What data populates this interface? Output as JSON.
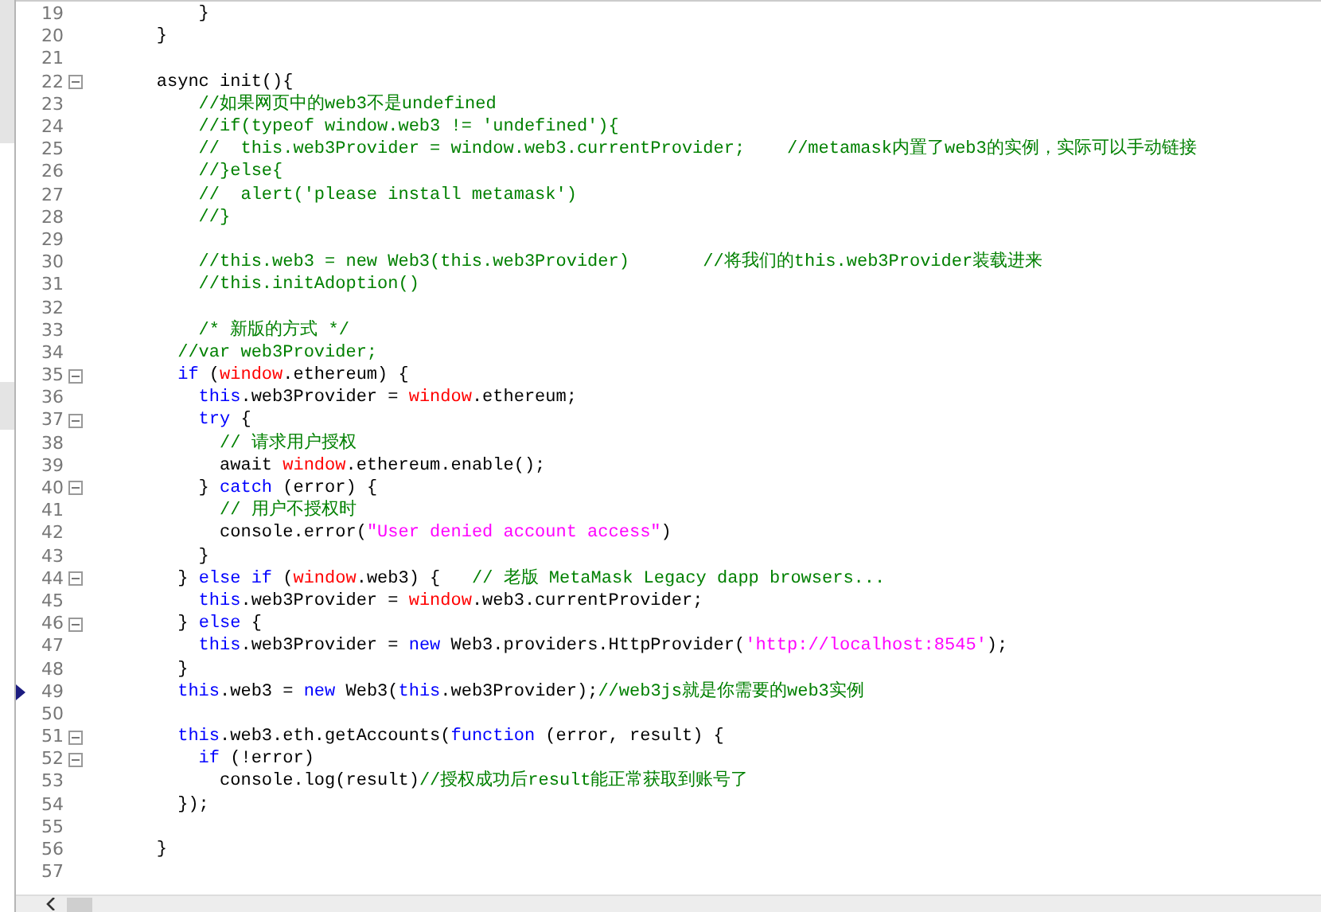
{
  "editor": {
    "lines": [
      {
        "number": "19",
        "foldable": false,
        "bookmark": false,
        "tokens": [
          {
            "kind": "text",
            "text": "        }"
          }
        ]
      },
      {
        "number": "20",
        "foldable": false,
        "bookmark": false,
        "tokens": [
          {
            "kind": "text",
            "text": "    }"
          }
        ]
      },
      {
        "number": "21",
        "foldable": false,
        "bookmark": false
      },
      {
        "number": "22",
        "foldable": true,
        "bookmark": false,
        "tokens": [
          {
            "kind": "text",
            "text": "    async init(){"
          }
        ]
      },
      {
        "number": "23",
        "foldable": false,
        "bookmark": false,
        "tokens": [
          {
            "kind": "comment",
            "text": "        //如果网页中的web3不是undefined"
          }
        ]
      },
      {
        "number": "24",
        "foldable": false,
        "bookmark": false,
        "tokens": [
          {
            "kind": "comment",
            "text": "        //if(typeof window.web3 != 'undefined'){"
          }
        ]
      },
      {
        "number": "25",
        "foldable": false,
        "bookmark": false,
        "tokens": [
          {
            "kind": "comment",
            "text": "        //  this.web3Provider = window.web3.currentProvider;    //metamask内置了web3的实例，实际可以手动链接"
          }
        ]
      },
      {
        "number": "26",
        "foldable": false,
        "bookmark": false,
        "tokens": [
          {
            "kind": "comment",
            "text": "        //}else{"
          }
        ]
      },
      {
        "number": "27",
        "foldable": false,
        "bookmark": false,
        "tokens": [
          {
            "kind": "comment",
            "text": "        //  alert('please install metamask')"
          }
        ]
      },
      {
        "number": "28",
        "foldable": false,
        "bookmark": false,
        "tokens": [
          {
            "kind": "comment",
            "text": "        //}"
          }
        ]
      },
      {
        "number": "29",
        "foldable": false,
        "bookmark": false
      },
      {
        "number": "30",
        "foldable": false,
        "bookmark": false,
        "tokens": [
          {
            "kind": "comment",
            "text": "        //this.web3 = new Web3(this.web3Provider)       //将我们的this.web3Provider装载进来"
          }
        ]
      },
      {
        "number": "31",
        "foldable": false,
        "bookmark": false,
        "tokens": [
          {
            "kind": "comment",
            "text": "        //this.initAdoption()"
          }
        ]
      },
      {
        "number": "32",
        "foldable": false,
        "bookmark": false
      },
      {
        "number": "33",
        "foldable": false,
        "bookmark": false,
        "tokens": [
          {
            "kind": "comment",
            "text": "        /* 新版的方式 */"
          }
        ]
      },
      {
        "number": "34",
        "foldable": false,
        "bookmark": false,
        "tokens": [
          {
            "kind": "comment",
            "text": "      //var web3Provider;"
          }
        ]
      },
      {
        "number": "35",
        "foldable": true,
        "bookmark": false,
        "tokens": [
          {
            "kind": "keyword",
            "text": "      if"
          },
          {
            "kind": "text",
            "text": " ("
          },
          {
            "kind": "global",
            "text": "window"
          },
          {
            "kind": "text",
            "text": ".ethereum) {"
          }
        ]
      },
      {
        "number": "36",
        "foldable": false,
        "bookmark": false,
        "tokens": [
          {
            "kind": "keyword",
            "text": "        this"
          },
          {
            "kind": "text",
            "text": ".web3Provider = "
          },
          {
            "kind": "global",
            "text": "window"
          },
          {
            "kind": "text",
            "text": ".ethereum;"
          }
        ]
      },
      {
        "number": "37",
        "foldable": true,
        "bookmark": false,
        "tokens": [
          {
            "kind": "keyword",
            "text": "        try"
          },
          {
            "kind": "text",
            "text": " {"
          }
        ]
      },
      {
        "number": "38",
        "foldable": false,
        "bookmark": false,
        "tokens": [
          {
            "kind": "comment",
            "text": "          // 请求用户授权"
          }
        ]
      },
      {
        "number": "39",
        "foldable": false,
        "bookmark": false,
        "tokens": [
          {
            "kind": "text",
            "text": "          await "
          },
          {
            "kind": "global",
            "text": "window"
          },
          {
            "kind": "text",
            "text": ".ethereum.enable();"
          }
        ]
      },
      {
        "number": "40",
        "foldable": true,
        "bookmark": false,
        "tokens": [
          {
            "kind": "text",
            "text": "        } "
          },
          {
            "kind": "keyword",
            "text": "catch"
          },
          {
            "kind": "text",
            "text": " (error) {"
          }
        ]
      },
      {
        "number": "41",
        "foldable": false,
        "bookmark": false,
        "tokens": [
          {
            "kind": "comment",
            "text": "          // 用户不授权时"
          }
        ]
      },
      {
        "number": "42",
        "foldable": false,
        "bookmark": false,
        "tokens": [
          {
            "kind": "text",
            "text": "          console.error("
          },
          {
            "kind": "string",
            "text": "\"User denied account access\""
          },
          {
            "kind": "text",
            "text": ")"
          }
        ]
      },
      {
        "number": "43",
        "foldable": false,
        "bookmark": false,
        "tokens": [
          {
            "kind": "text",
            "text": "        }"
          }
        ]
      },
      {
        "number": "44",
        "foldable": true,
        "bookmark": false,
        "tokens": [
          {
            "kind": "text",
            "text": "      } "
          },
          {
            "kind": "keyword",
            "text": "else if"
          },
          {
            "kind": "text",
            "text": " ("
          },
          {
            "kind": "global",
            "text": "window"
          },
          {
            "kind": "text",
            "text": ".web3) {   "
          },
          {
            "kind": "comment",
            "text": "// 老版 MetaMask Legacy dapp browsers..."
          }
        ]
      },
      {
        "number": "45",
        "foldable": false,
        "bookmark": false,
        "tokens": [
          {
            "kind": "keyword",
            "text": "        this"
          },
          {
            "kind": "text",
            "text": ".web3Provider = "
          },
          {
            "kind": "global",
            "text": "window"
          },
          {
            "kind": "text",
            "text": ".web3.currentProvider;"
          }
        ]
      },
      {
        "number": "46",
        "foldable": true,
        "bookmark": false,
        "tokens": [
          {
            "kind": "text",
            "text": "      } "
          },
          {
            "kind": "keyword",
            "text": "else"
          },
          {
            "kind": "text",
            "text": " {"
          }
        ]
      },
      {
        "number": "47",
        "foldable": false,
        "bookmark": false,
        "tokens": [
          {
            "kind": "keyword",
            "text": "        this"
          },
          {
            "kind": "text",
            "text": ".web3Provider = "
          },
          {
            "kind": "keyword",
            "text": "new"
          },
          {
            "kind": "text",
            "text": " Web3.providers.HttpProvider("
          },
          {
            "kind": "string",
            "text": "'http://localhost:8545'"
          },
          {
            "kind": "text",
            "text": ");"
          }
        ]
      },
      {
        "number": "48",
        "foldable": false,
        "bookmark": false,
        "tokens": [
          {
            "kind": "text",
            "text": "      }"
          }
        ]
      },
      {
        "number": "49",
        "foldable": false,
        "bookmark": true,
        "tokens": [
          {
            "kind": "keyword",
            "text": "      this"
          },
          {
            "kind": "text",
            "text": ".web3 = "
          },
          {
            "kind": "keyword",
            "text": "new"
          },
          {
            "kind": "text",
            "text": " Web3("
          },
          {
            "kind": "keyword",
            "text": "this"
          },
          {
            "kind": "text",
            "text": ".web3Provider);"
          },
          {
            "kind": "comment",
            "text": "//web3js就是你需要的web3实例"
          }
        ]
      },
      {
        "number": "50",
        "foldable": false,
        "bookmark": false
      },
      {
        "number": "51",
        "foldable": true,
        "bookmark": false,
        "tokens": [
          {
            "kind": "keyword",
            "text": "      this"
          },
          {
            "kind": "text",
            "text": ".web3.eth.getAccounts("
          },
          {
            "kind": "keyword",
            "text": "function"
          },
          {
            "kind": "text",
            "text": " (error, result) {"
          }
        ]
      },
      {
        "number": "52",
        "foldable": true,
        "bookmark": false,
        "tokens": [
          {
            "kind": "keyword",
            "text": "        if"
          },
          {
            "kind": "text",
            "text": " (!error)"
          }
        ]
      },
      {
        "number": "53",
        "foldable": false,
        "bookmark": false,
        "tokens": [
          {
            "kind": "text",
            "text": "          console.log(result)"
          },
          {
            "kind": "comment",
            "text": "//授权成功后result能正常获取到账号了"
          }
        ]
      },
      {
        "number": "54",
        "foldable": false,
        "bookmark": false,
        "tokens": [
          {
            "kind": "text",
            "text": "      });"
          }
        ]
      },
      {
        "number": "55",
        "foldable": false,
        "bookmark": false
      },
      {
        "number": "56",
        "foldable": false,
        "bookmark": false,
        "tokens": [
          {
            "kind": "text",
            "text": "    }"
          }
        ]
      },
      {
        "number": "57",
        "foldable": false,
        "bookmark": false
      }
    ]
  }
}
